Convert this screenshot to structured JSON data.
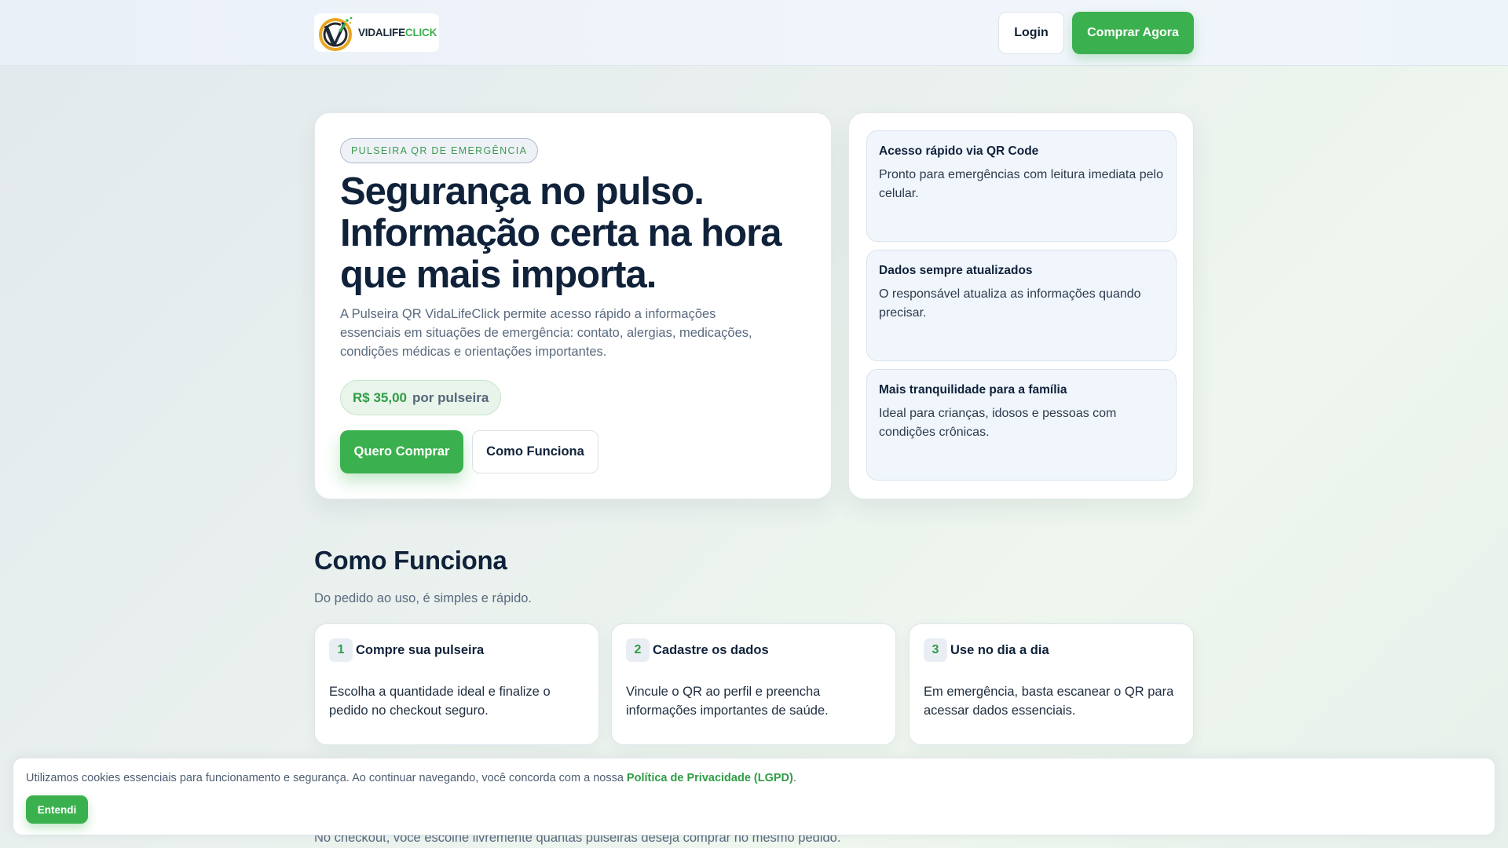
{
  "header": {
    "logo_text_a": "VIDALIFE",
    "logo_text_b": "CLICK",
    "login_label": "Login",
    "buy_label": "Comprar Agora"
  },
  "hero": {
    "eyebrow": "PULSEIRA QR DE EMERGÊNCIA",
    "title_lines": [
      "Segurança no pulso.",
      "Informação certa na hora",
      "que mais importa."
    ],
    "description": "A Pulseira QR VidaLifeClick permite acesso rápido a informações essenciais em situações de emergência: contato, alergias, medicações, condições médicas e orientações importantes.",
    "price_value": "R$ 35,00",
    "price_unit": "por pulseira",
    "primary_button": "Quero Comprar",
    "secondary_button": "Como Funciona"
  },
  "features": [
    {
      "title": "Acesso rápido via QR Code",
      "text": "Pronto para emergências com leitura imediata pelo celular."
    },
    {
      "title": "Dados sempre atualizados",
      "text": "O responsável atualiza as informações quando precisar."
    },
    {
      "title": "Mais tranquilidade para a família",
      "text": "Ideal para crianças, idosos e pessoas com condições crônicas."
    }
  ],
  "how_it_works": {
    "title": "Como Funciona",
    "subtitle": "Do pedido ao uso, é simples e rápido.",
    "steps": [
      {
        "num": "1",
        "title": "Compre sua pulseira",
        "text": "Escolha a quantidade ideal e finalize o pedido no checkout seguro."
      },
      {
        "num": "2",
        "title": "Cadastre os dados",
        "text": "Vincule o QR ao perfil e preencha informações importantes de saúde."
      },
      {
        "num": "3",
        "title": "Use no dia a dia",
        "text": "Em emergência, basta escanear o QR para acessar dados essenciais."
      }
    ]
  },
  "behind_text": "No checkout, você escolhe livremente quantas pulseiras deseja comprar no mesmo pedido.",
  "cookie": {
    "text": "Utilizamos cookies essenciais para funcionamento e segurança. Ao continuar navegando, você concorda com a nossa ",
    "link": "Política de Privacidade (LGPD)",
    "end": ".",
    "button": "Entendi"
  },
  "colors": {
    "brand_green": "#3ab14e",
    "navy": "#10223a"
  }
}
